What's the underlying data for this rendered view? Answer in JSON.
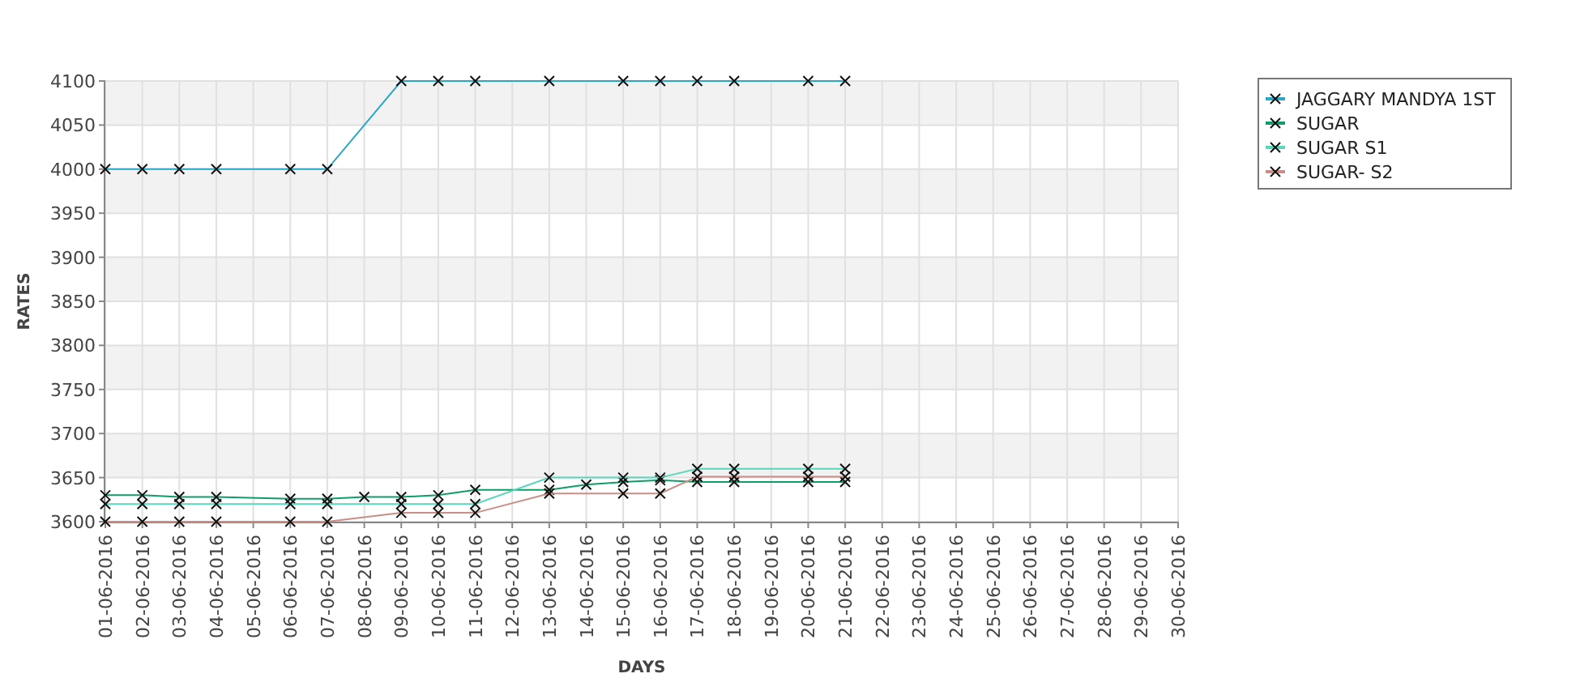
{
  "chart": {
    "chart_data": {
      "type": "line",
      "xlabel": "DAYS",
      "ylabel": "RATES",
      "categories": [
        "01-06-2016",
        "02-06-2016",
        "03-06-2016",
        "04-06-2016",
        "05-06-2016",
        "06-06-2016",
        "07-06-2016",
        "08-06-2016",
        "09-06-2016",
        "10-06-2016",
        "11-06-2016",
        "12-06-2016",
        "13-06-2016",
        "14-06-2016",
        "15-06-2016",
        "16-06-2016",
        "17-06-2016",
        "18-06-2016",
        "19-06-2016",
        "20-06-2016",
        "21-06-2016",
        "22-06-2016",
        "23-06-2016",
        "24-06-2016",
        "25-06-2016",
        "26-06-2016",
        "27-06-2016",
        "28-06-2016",
        "29-06-2016",
        "30-06-2016"
      ],
      "series": [
        {
          "name": "JAGGARY MANDYA 1ST",
          "color": "#2aa7c4",
          "marker": "cross",
          "values": [
            4000,
            4000,
            4000,
            4000,
            null,
            4000,
            4000,
            null,
            4100,
            4100,
            4100,
            null,
            4100,
            null,
            4100,
            4100,
            4100,
            4100,
            null,
            4100,
            4100,
            null,
            null,
            null,
            null,
            null,
            null,
            null,
            null,
            null
          ]
        },
        {
          "name": "SUGAR",
          "color": "#0f9d6a",
          "marker": "cross",
          "values": [
            3630,
            3630,
            3628,
            3628,
            null,
            3626,
            3626,
            3628,
            3628,
            3630,
            3636,
            null,
            3636,
            3642,
            3645,
            3647,
            3645,
            3645,
            null,
            3645,
            3645,
            null,
            null,
            null,
            null,
            null,
            null,
            null,
            null,
            null
          ]
        },
        {
          "name": "SUGAR S1",
          "color": "#5ad6bb",
          "marker": "cross",
          "values": [
            3620,
            3620,
            3620,
            3620,
            null,
            3620,
            3620,
            null,
            3620,
            3620,
            3620,
            null,
            3650,
            null,
            3650,
            3650,
            3660,
            3660,
            null,
            3660,
            3660,
            null,
            null,
            null,
            null,
            null,
            null,
            null,
            null,
            null
          ]
        },
        {
          "name": "SUGAR- S2",
          "color": "#c98f86",
          "marker": "cross",
          "values": [
            3600,
            3600,
            3600,
            3600,
            null,
            3600,
            3600,
            null,
            3610,
            3610,
            3610,
            null,
            3632,
            null,
            3632,
            3632,
            3651,
            3651,
            null,
            3651,
            3651,
            null,
            null,
            null,
            null,
            null,
            null,
            null,
            null,
            null
          ]
        }
      ],
      "grid": true,
      "legend": true,
      "ylim": [
        3600,
        4100
      ],
      "yticks": [
        3600,
        3650,
        3700,
        3750,
        3800,
        3850,
        3900,
        3950,
        4000,
        4050,
        4100
      ]
    }
  }
}
